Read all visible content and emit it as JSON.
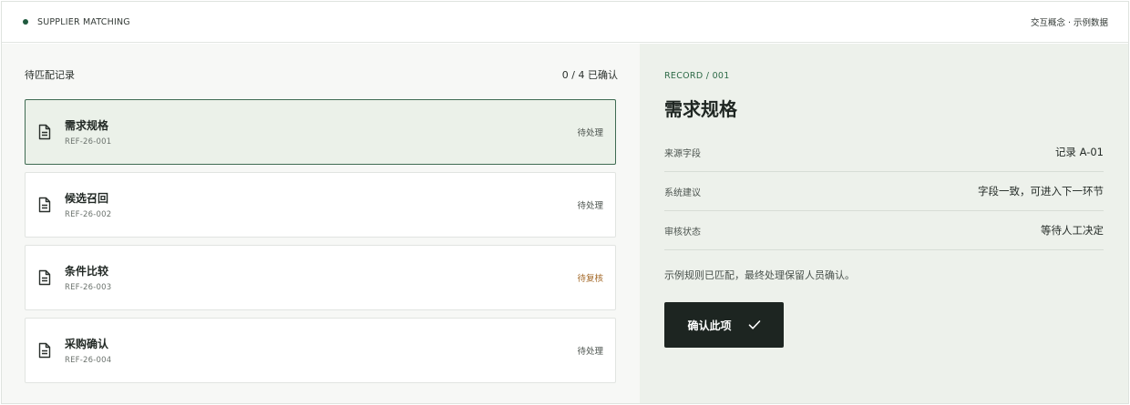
{
  "header": {
    "brand_label": "SUPPLIER MATCHING",
    "note": "交互概念 · 示例数据",
    "accent": "#1f5a3e"
  },
  "list": {
    "title": "待匹配记录",
    "progress": "0 / 4 已确认",
    "items": [
      {
        "title": "需求规格",
        "ref": "REF-26-001",
        "status": "待处理",
        "icon": "document-icon",
        "active": true
      },
      {
        "title": "候选召回",
        "ref": "REF-26-002",
        "status": "待处理",
        "icon": "document-icon",
        "active": false
      },
      {
        "title": "条件比较",
        "ref": "REF-26-003",
        "status": "待复核",
        "icon": "document-icon",
        "active": false
      },
      {
        "title": "采购确认",
        "ref": "REF-26-004",
        "status": "待处理",
        "icon": "document-icon",
        "active": false
      }
    ]
  },
  "detail": {
    "breadcrumb": "RECORD / 001",
    "title": "需求规格",
    "fields": [
      {
        "key": "来源字段",
        "value": "记录 A-01"
      },
      {
        "key": "系统建议",
        "value": "字段一致，可进入下一环节"
      },
      {
        "key": "审核状态",
        "value": "等待人工决定"
      }
    ],
    "note": "示例规则已匹配，最终处理保留人员确认。",
    "confirm_label": "确认此项",
    "confirm_icon": "check-icon"
  },
  "colors": {
    "active_bg": "#ebf1e9",
    "active_border": "#3f6b52",
    "review_status": "#a46a2a",
    "button_bg": "#1d2521"
  }
}
